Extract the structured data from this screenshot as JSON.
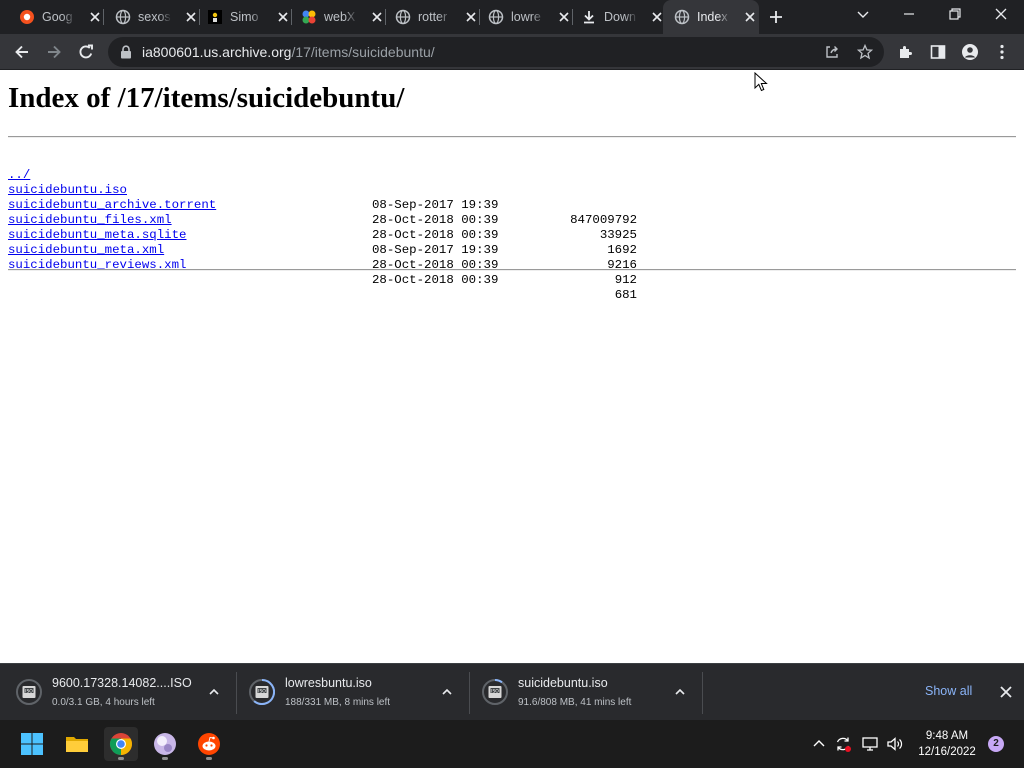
{
  "browser": {
    "tabs": [
      {
        "title": "Goog",
        "icon": "google-drive-icon"
      },
      {
        "title": "sexos",
        "icon": "globe-icon"
      },
      {
        "title": "Simo",
        "icon": "site-icon"
      },
      {
        "title": "webX",
        "icon": "webx-icon"
      },
      {
        "title": "rotter",
        "icon": "globe-icon"
      },
      {
        "title": "lowre",
        "icon": "globe-icon"
      },
      {
        "title": "Down",
        "icon": "download-icon"
      },
      {
        "title": "Index",
        "icon": "globe-icon"
      }
    ],
    "active_tab": 7,
    "address": {
      "host": "ia800601.us.archive.org",
      "path": "/17/items/suicidebuntu/"
    }
  },
  "page": {
    "title": "Index of /17/items/suicidebuntu/",
    "parent_link": "../",
    "files": [
      {
        "name": "suicidebuntu.iso",
        "date": "08-Sep-2017 19:39",
        "size": "847009792"
      },
      {
        "name": "suicidebuntu_archive.torrent",
        "date": "28-Oct-2018 00:39",
        "size": "33925"
      },
      {
        "name": "suicidebuntu_files.xml",
        "date": "28-Oct-2018 00:39",
        "size": "1692"
      },
      {
        "name": "suicidebuntu_meta.sqlite",
        "date": "08-Sep-2017 19:39",
        "size": "9216"
      },
      {
        "name": "suicidebuntu_meta.xml",
        "date": "28-Oct-2018 00:39",
        "size": "912"
      },
      {
        "name": "suicidebuntu_reviews.xml",
        "date": "28-Oct-2018 00:39",
        "size": "681"
      }
    ]
  },
  "downloads": {
    "items": [
      {
        "name": "9600.17328.14082....ISO",
        "status": "0.0/3.1 GB, 4 hours left",
        "progress": 0.0
      },
      {
        "name": "lowresbuntu.iso",
        "status": "188/331 MB, 8 mins left",
        "progress": 0.57
      },
      {
        "name": "suicidebuntu.iso",
        "status": "91.6/808 MB, 41 mins left",
        "progress": 0.11
      }
    ],
    "show_all": "Show all"
  },
  "taskbar": {
    "apps": [
      "windows-start-icon",
      "file-explorer-icon",
      "chrome-icon",
      "marble-app-icon",
      "reddit-icon"
    ],
    "time": "9:48 AM",
    "date": "12/16/2022",
    "notifications": "2"
  },
  "colors": {
    "link": "#0000ee",
    "chrome_dark": "#202124",
    "toolbar": "#35363a",
    "show_all": "#8ab4f8"
  }
}
